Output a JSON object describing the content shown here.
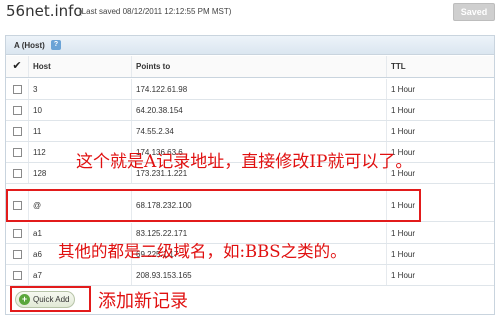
{
  "header": {
    "domain": "56net.info",
    "saved_note": "(Last saved 08/12/2011 12:12:55 PM MST)",
    "saved_button": "Saved"
  },
  "panel": {
    "title": "A (Host)",
    "help_icon": "help-icon",
    "help_glyph": "?",
    "columns": {
      "check": "✔",
      "host": "Host",
      "points_to": "Points to",
      "ttl": "TTL"
    }
  },
  "records": [
    {
      "host": "3",
      "points_to": "174.122.61.98",
      "ttl": "1 Hour"
    },
    {
      "host": "10",
      "points_to": "64.20.38.154",
      "ttl": "1 Hour"
    },
    {
      "host": "11",
      "points_to": "74.55.2.34",
      "ttl": "1 Hour"
    },
    {
      "host": "112",
      "points_to": "174.136.63.6",
      "ttl": "1 Hour"
    },
    {
      "host": "128",
      "points_to": "173.231.1.221",
      "ttl": "1 Hour"
    },
    {
      "host": "@",
      "points_to": "68.178.232.100",
      "ttl": "1 Hour"
    },
    {
      "host": "a1",
      "points_to": "83.125.22.171",
      "ttl": "1 Hour"
    },
    {
      "host": "a6",
      "points_to": "69.225.1.17",
      "ttl": "1 Hour"
    },
    {
      "host": "a7",
      "points_to": "208.93.153.165",
      "ttl": "1 Hour"
    }
  ],
  "quick_add": {
    "label": "Quick Add",
    "icon": "plus-icon",
    "glyph": "+"
  },
  "annotations": {
    "at_record": "这个就是A记录地址，直接修改IP就可以了。",
    "subdomain": "其他的都是二级域名，如:BBS之类的。",
    "add_new": "添加新记录"
  },
  "colors": {
    "annotation_red": "#e01010",
    "help_blue": "#6aa3d6",
    "add_green": "#5aa63c"
  }
}
